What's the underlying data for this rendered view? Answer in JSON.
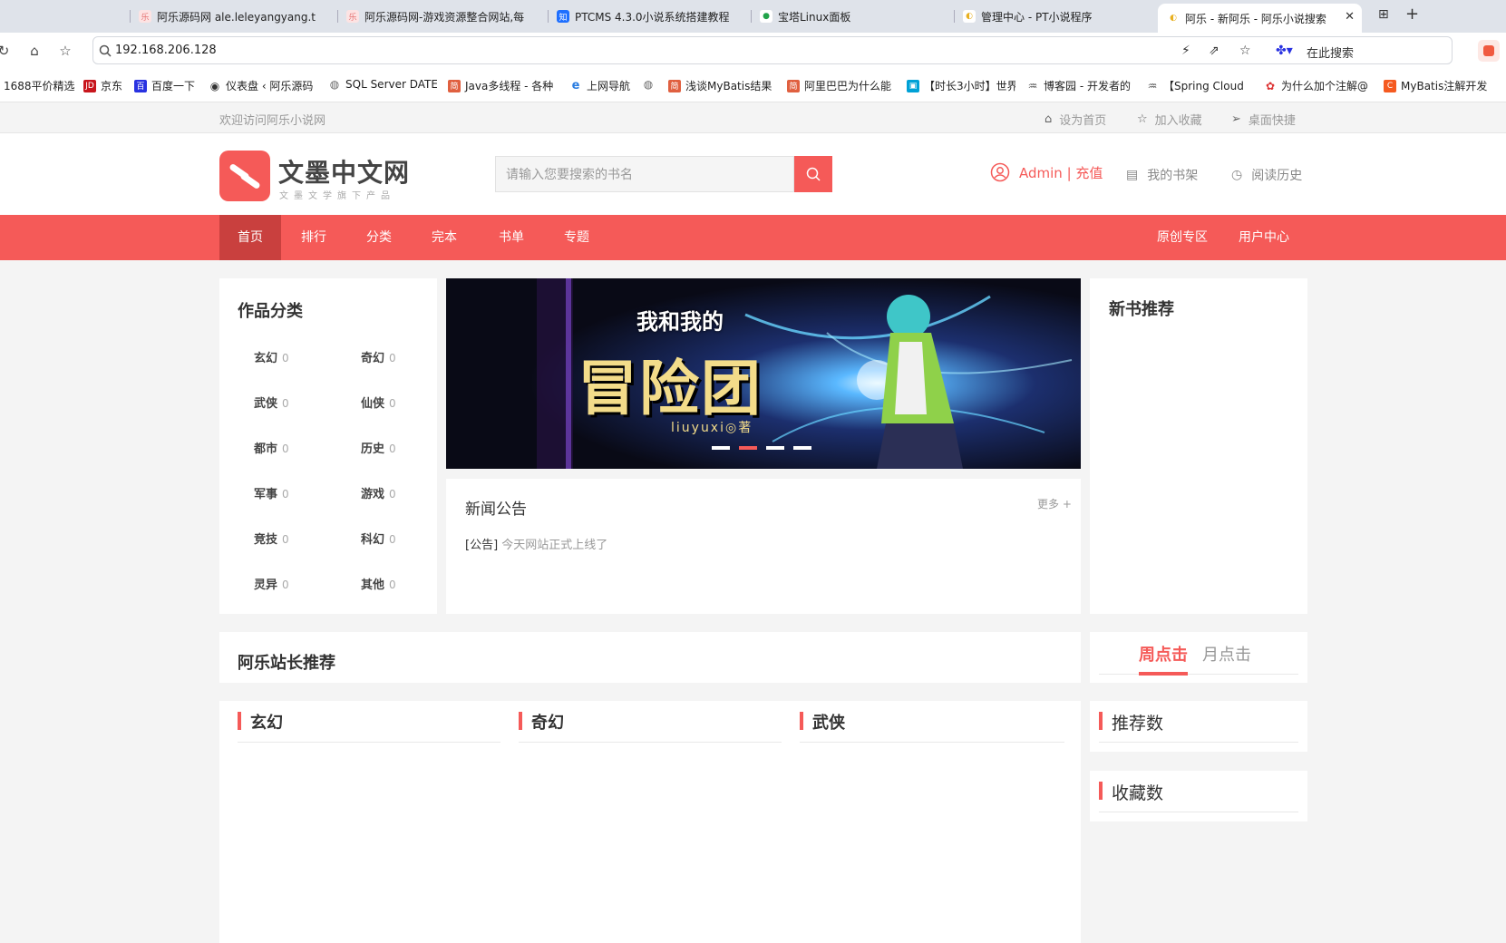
{
  "browser": {
    "tabs": [
      {
        "label": "阿乐源码网 ale.leleyangyang.to",
        "color": "#f7c0c0",
        "glyph": "乐"
      },
      {
        "label": "阿乐源码网-游戏资源整合网站,每",
        "color": "#f7c0c0",
        "glyph": "乐"
      },
      {
        "label": "PTCMS 4.3.0小说系统搭建教程",
        "color": "#1e6fff",
        "glyph": "知"
      },
      {
        "label": "宝塔Linux面板",
        "color": "#22a34a",
        "glyph": "●"
      },
      {
        "label": "管理中心 - PT小说程序",
        "color": "#e8b020",
        "glyph": "◐"
      },
      {
        "label": "阿乐 - 新阿乐 - 阿乐小说搜索",
        "color": "#e8b020",
        "glyph": "◐"
      }
    ],
    "close_glyph": "✕",
    "url": "192.168.206.128",
    "search_hint": "在此搜索",
    "bookmarks": [
      {
        "label": "1688平价精选",
        "color": "",
        "glyph": ""
      },
      {
        "label": "京东",
        "color": "#c8161d",
        "glyph": "JD"
      },
      {
        "label": "百度一下",
        "color": "#2932e1",
        "glyph": "百"
      },
      {
        "label": "仪表盘 ‹ 阿乐源码",
        "color": "#333",
        "glyph": "◉"
      },
      {
        "label": "SQL Server DATE",
        "color": "#666",
        "glyph": "◍"
      },
      {
        "label": "Java多线程 - 各种",
        "color": "#e06040",
        "glyph": "简"
      },
      {
        "label": "上网导航",
        "color": "#2a7de1",
        "glyph": "e"
      },
      {
        "label": "",
        "color": "#666",
        "glyph": "◍"
      },
      {
        "label": "浅谈MyBatis结果",
        "color": "#e06040",
        "glyph": "简"
      },
      {
        "label": "阿里巴巴为什么能",
        "color": "#e06040",
        "glyph": "简"
      },
      {
        "label": "【时长3小时】世界",
        "color": "#00a1d6",
        "glyph": "▣"
      },
      {
        "label": "博客园 - 开发者的",
        "color": "#555",
        "glyph": "♒"
      },
      {
        "label": "【Spring Cloud",
        "color": "#555",
        "glyph": "♒"
      },
      {
        "label": "为什么加个注解@",
        "color": "#d33",
        "glyph": "✿"
      },
      {
        "label": "MyBatis注解开发",
        "color": "#f55a20",
        "glyph": "C"
      }
    ]
  },
  "site": {
    "welcome": "欢迎访问阿乐小说网",
    "top_links": [
      "设为首页",
      "加入收藏",
      "桌面快捷"
    ],
    "logo_title": "文墨中文网",
    "logo_sub": "文墨文学旗下产品",
    "search_placeholder": "请输入您要搜索的书名",
    "user_link": "Admin | 充值",
    "bookshelf": "我的书架",
    "history": "阅读历史",
    "nav": [
      "首页",
      "排行",
      "分类",
      "完本",
      "书单",
      "专题"
    ],
    "nav_right": [
      "原创专区",
      "用户中心"
    ],
    "accent": "#f55a58"
  },
  "categories_panel": {
    "title": "作品分类",
    "items": [
      {
        "name": "玄幻",
        "count": "0"
      },
      {
        "name": "奇幻",
        "count": "0"
      },
      {
        "name": "武侠",
        "count": "0"
      },
      {
        "name": "仙侠",
        "count": "0"
      },
      {
        "name": "都市",
        "count": "0"
      },
      {
        "name": "历史",
        "count": "0"
      },
      {
        "name": "军事",
        "count": "0"
      },
      {
        "name": "游戏",
        "count": "0"
      },
      {
        "name": "竞技",
        "count": "0"
      },
      {
        "name": "科幻",
        "count": "0"
      },
      {
        "name": "灵异",
        "count": "0"
      },
      {
        "name": "其他",
        "count": "0"
      }
    ]
  },
  "banner": {
    "top_text": "我和我的",
    "main_text": "冒险团",
    "author": "liuyuxi◎著",
    "slides": 4,
    "active_slide": 2
  },
  "news": {
    "title": "新闻公告",
    "more": "更多 +",
    "items": [
      {
        "tag": "[公告]",
        "text": "今天网站正式上线了"
      }
    ]
  },
  "new_books": {
    "title": "新书推荐"
  },
  "recommend": {
    "title": "阿乐站长推荐",
    "columns": [
      "玄幻",
      "奇幻",
      "武侠"
    ]
  },
  "rank": {
    "tabs": [
      "周点击",
      "月点击"
    ],
    "sections": [
      "推荐数",
      "收藏数"
    ]
  }
}
